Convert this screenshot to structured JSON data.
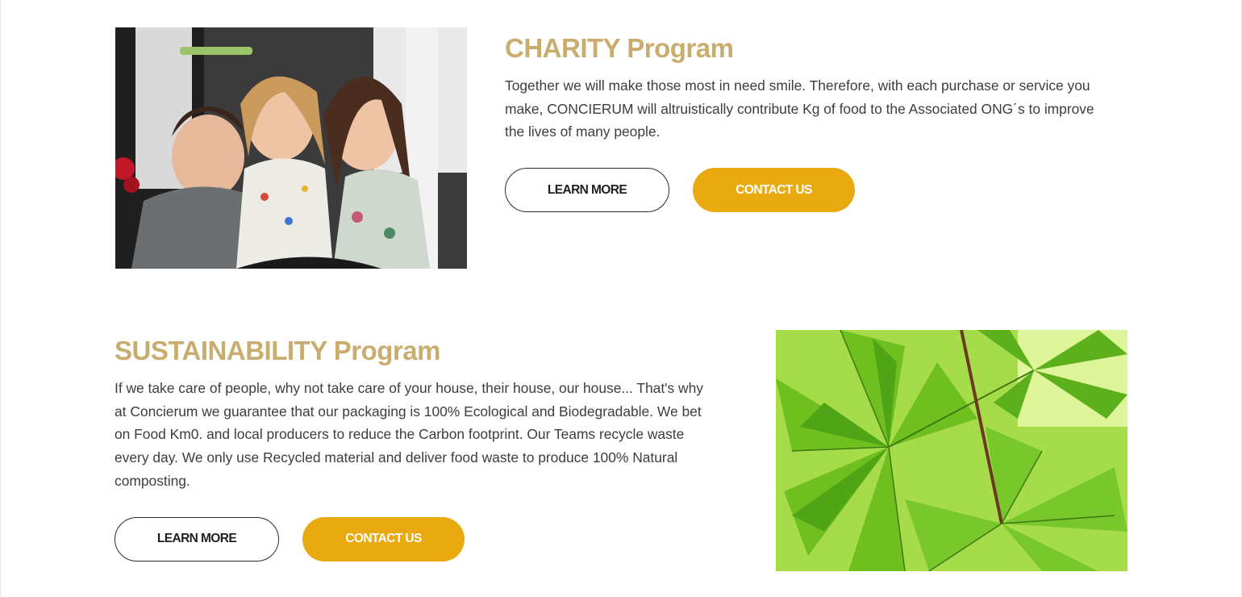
{
  "charity": {
    "title": "CHARITY Program",
    "body": "Together we will make those most in need smile. Therefore, with each purchase or service you make, CONCIERUM will altruistically contribute Kg of food to the Associated ONG´s to improve the lives of many people.",
    "learn_more_label": "LEARN MORE",
    "contact_label": "CONTACT US",
    "image_subject": "three-smiling-children-photo"
  },
  "sustainability": {
    "title": "SUSTAINABILITY Program",
    "body": "If we take care of people, why not take care of your house, their house, our house... That's why at Concierum we guarantee that our packaging is 100% Ecological and Biodegradable. We bet on Food Km0. and local producers to reduce the Carbon footprint. Our Teams recycle waste every day. We only use Recycled material and deliver food waste to produce 100% Natural composting.",
    "learn_more_label": "LEARN MORE",
    "contact_label": "CONTACT US",
    "image_subject": "green-leaves-photo"
  },
  "colors": {
    "heading": "#c9ad6e",
    "accent_button": "#e8aa0e",
    "body_text": "#3d3d3d"
  }
}
